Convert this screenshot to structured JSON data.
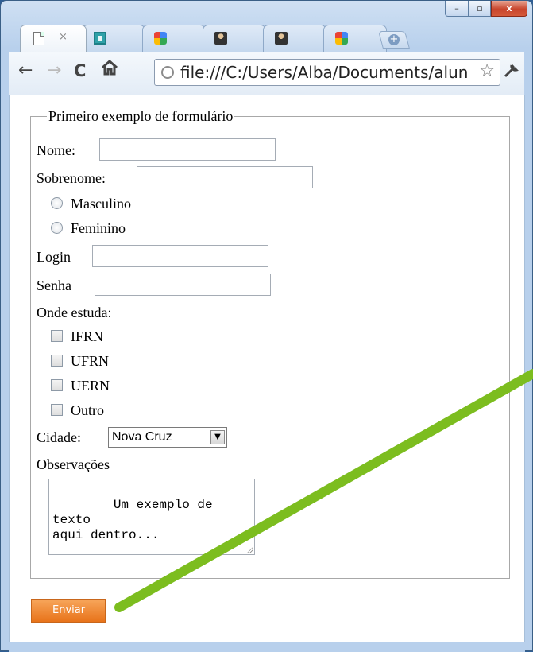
{
  "window": {
    "caption": {
      "minimize": "–",
      "maximize": "▫",
      "close": "x"
    }
  },
  "tabs": [
    {
      "icon": "page-icon",
      "close": "×"
    },
    {
      "icon": "square-icon"
    },
    {
      "icon": "google-icon"
    },
    {
      "icon": "avatar-icon"
    },
    {
      "icon": "avatar-icon"
    },
    {
      "icon": "google-icon"
    }
  ],
  "toolbar": {
    "back": "←",
    "forward": "→",
    "reload": "C",
    "home": "🏠",
    "url": "file:///C:/Users/Alba/Documents/alun",
    "star": "☆",
    "wrench": "🔧"
  },
  "form": {
    "legend": "Primeiro exemplo de formulário",
    "nome_label": "Nome:",
    "sobrenome_label": "Sobrenome:",
    "gender_options": [
      "Masculino",
      "Feminino"
    ],
    "login_label": "Login",
    "senha_label": "Senha",
    "onde_label": "Onde estuda:",
    "school_options": [
      "IFRN",
      "UFRN",
      "UERN",
      "Outro"
    ],
    "cidade_label": "Cidade:",
    "cidade_value": "Nova Cruz",
    "obs_label": "Observações",
    "obs_value": "Um exemplo de texto\naqui dentro...",
    "submit_label": "Enviar"
  },
  "colors": {
    "submit": "#f08a2a",
    "annotation": "#7cbd1f"
  }
}
